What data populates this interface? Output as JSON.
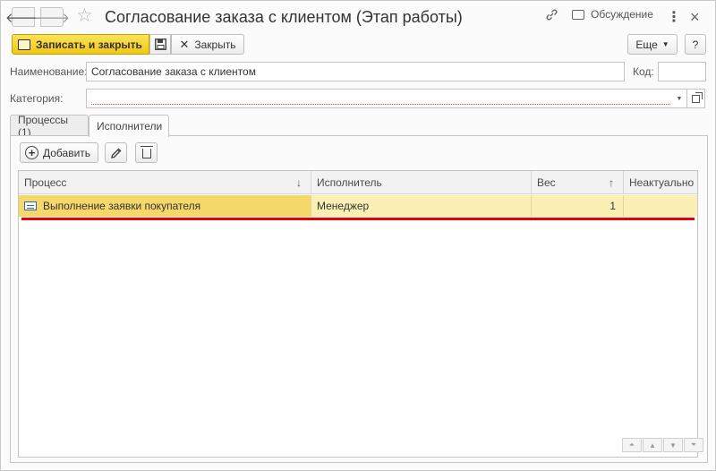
{
  "titlebar": {
    "title": "Согласование заказа с клиентом (Этап работы)",
    "discussion_label": "Обсуждение",
    "back_glyph": "🡐",
    "forward_glyph": "🡒",
    "star_glyph": "☆",
    "link_glyph": "🔗",
    "more_glyph": "⋮",
    "close_glyph": "×"
  },
  "toolbar": {
    "save_and_close_label": "Записать и закрыть",
    "close_label": "Закрыть",
    "more_label": "Еще",
    "help_label": "?"
  },
  "form": {
    "name_label": "Наименование:",
    "name_value": "Согласование заказа с клиентом",
    "code_label": "Код:",
    "code_value": "",
    "category_label": "Категория:",
    "category_value": ""
  },
  "tabs": [
    {
      "label": "Процессы (1)",
      "active": false
    },
    {
      "label": "Исполнители",
      "active": true
    }
  ],
  "panel_toolbar": {
    "add_label": "Добавить"
  },
  "table": {
    "columns": [
      {
        "label": "Процесс",
        "sort": "↓"
      },
      {
        "label": "Исполнитель",
        "sort": ""
      },
      {
        "label": "Вес",
        "sort": "↑"
      },
      {
        "label": "Неактуально",
        "sort": ""
      }
    ],
    "rows": [
      {
        "process": "Выполнение заявки покупателя",
        "executor": "Менеджер",
        "weight": "1",
        "inactive": ""
      }
    ]
  },
  "colors": {
    "primary_button": "#f2c713",
    "selected_row": "#fbf0b4",
    "selected_cell": "#f4d86a",
    "highlight_line": "#e60000"
  },
  "icons": [
    "arrow-left-icon",
    "arrow-right-icon",
    "star-icon",
    "link-icon",
    "discussion-icon",
    "more-vertical-icon",
    "close-icon",
    "save-icon",
    "add-icon",
    "pencil-icon",
    "trash-icon",
    "process-icon"
  ]
}
